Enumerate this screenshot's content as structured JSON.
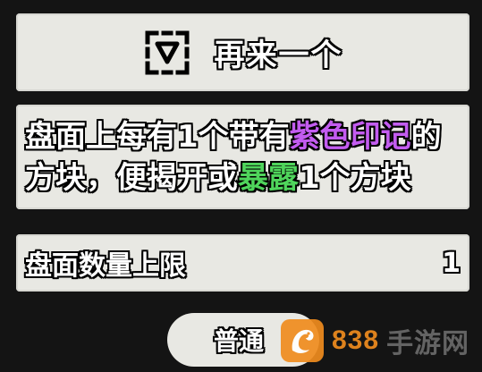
{
  "top_button": {
    "icon": "dashed-triangle-icon",
    "label": "再来一个"
  },
  "description": {
    "line1_part1": "盘面上每有1个带有",
    "line1_highlight": "紫色印记",
    "line1_part2": "的",
    "line2_part1": "方块，便揭开或",
    "line2_highlight": "暴露",
    "line2_part2": "1个方块",
    "highlight_colors": {
      "purple": "#c35cf0",
      "green": "#4fd45b"
    }
  },
  "count": {
    "label": "盘面数量上限",
    "value": "1"
  },
  "difficulty": {
    "label": "普通"
  },
  "watermark": {
    "number": "838",
    "text": "手游网",
    "logo_icon": "dragon-logo",
    "color": "#f08c1e"
  },
  "colors": {
    "background": "#141414",
    "panel": "#e8e8e3"
  }
}
